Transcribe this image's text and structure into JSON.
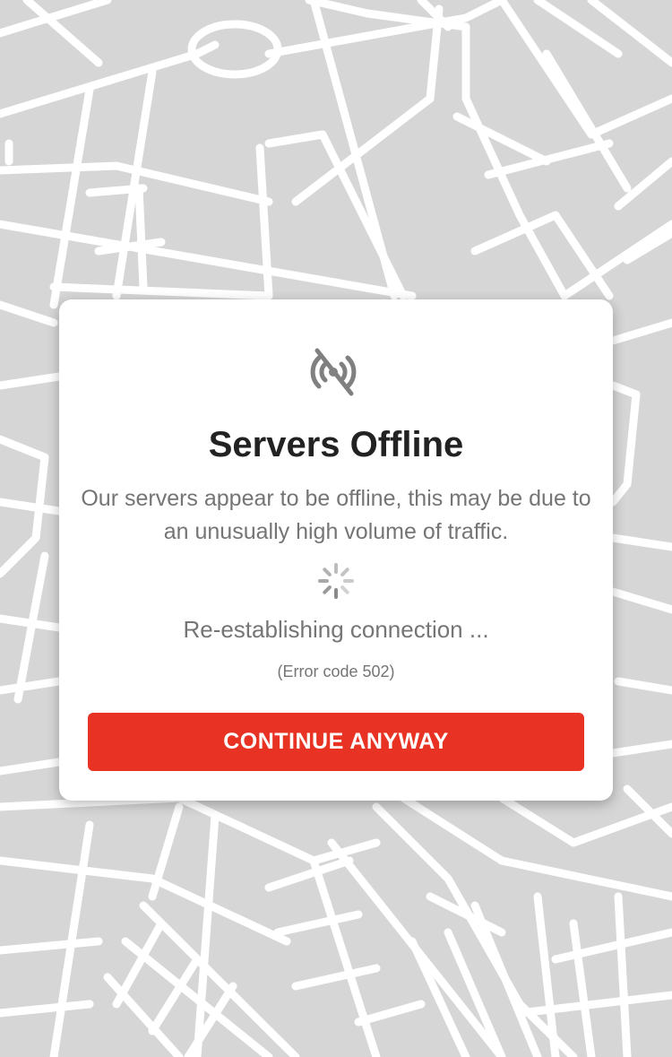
{
  "dialog": {
    "title": "Servers Offline",
    "message": "Our servers appear to be offline, this may be due to an unusually high volume of traffic.",
    "status": "Re-establishing connection ...",
    "error_code": "(Error code 502)",
    "continue_label": "CONTINUE ANYWAY",
    "icon": "signal-off-icon",
    "spinner_icon": "loading-spinner-icon"
  },
  "colors": {
    "map_background": "#d6d6d6",
    "map_roads": "#ffffff",
    "button": "#e83324",
    "title": "#222222",
    "body_text": "#757575"
  }
}
